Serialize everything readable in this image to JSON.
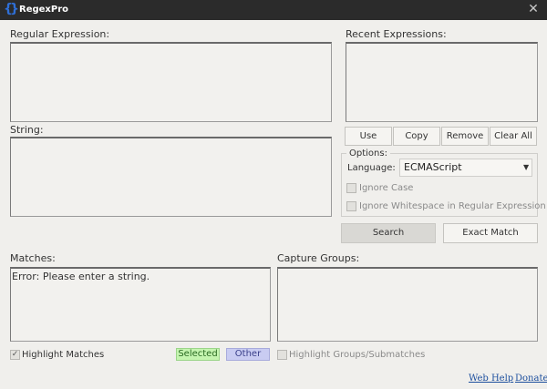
{
  "app": {
    "title": "RegexPro",
    "logo_glyph": "{}",
    "close_glyph": "✕"
  },
  "regex": {
    "label": "Regular Expression:",
    "value": ""
  },
  "string": {
    "label": "String:",
    "value": ""
  },
  "recent": {
    "label": "Recent Expressions:",
    "items": [],
    "buttons": {
      "use": "Use",
      "copy": "Copy",
      "remove": "Remove",
      "clear_all": "Clear All"
    }
  },
  "options": {
    "legend": "Options:",
    "language_label": "Language:",
    "language_value": "ECMAScript",
    "ignore_case_label": "Ignore Case",
    "ignore_case_checked": false,
    "ignore_whitespace_label": "Ignore Whitespace in Regular Expression",
    "ignore_whitespace_checked": false
  },
  "actions": {
    "search": "Search",
    "exact_match": "Exact Match"
  },
  "matches": {
    "label": "Matches:",
    "value": "Error: Please enter a string.",
    "highlight_label": "Highlight Matches",
    "highlight_checked": true,
    "legend_selected": "Selected",
    "legend_other": "Other"
  },
  "groups": {
    "label": "Capture Groups:",
    "value": "",
    "highlight_label": "Highlight Groups/Submatches",
    "highlight_checked": false
  },
  "footer": {
    "web_help": "Web Help",
    "donate": "Donate"
  },
  "colors": {
    "titlebar": "#2b2b2b",
    "window_bg": "#f0efec",
    "selected_chip": "#c5f5b0",
    "other_chip": "#c9ccf2",
    "link": "#1d4f9e",
    "logo": "#2f6fd6"
  },
  "icons": {
    "close": "close-icon",
    "logo": "braces-icon",
    "dropdown": "chevron-down-icon",
    "check": "checkmark-icon"
  }
}
